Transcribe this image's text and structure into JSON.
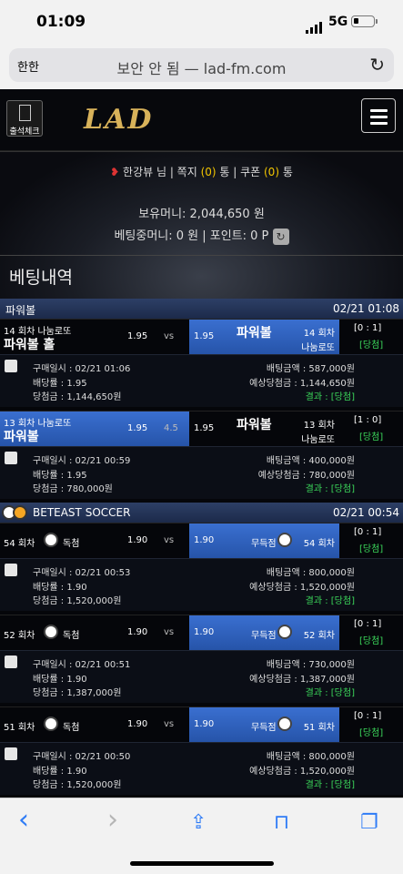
{
  "status": {
    "time": "01:09",
    "network": "5G"
  },
  "url_bar": {
    "aa": "한한",
    "address": "보안 안 됨 — lad-fm.com"
  },
  "site": {
    "attendance_label": "출석체크",
    "logo": "LAD"
  },
  "user": {
    "line": [
      "한강뷰 님 | 쪽지 ",
      "(0)",
      " 통 | 쿠폰 ",
      "(0)",
      " 통"
    ],
    "balance": "보유머니: 2,044,650 원",
    "betting": "베팅중머니: 0 원 | 포인트: 0 P"
  },
  "page_title": "베팅내역",
  "sections": [
    {
      "name": "파워볼",
      "datetime": "02/21 01:08",
      "bets": [
        {
          "home_top": "14 회차 나눔로또",
          "home_name": "파워볼 홀",
          "home_odds": "1.95",
          "mid": "vs",
          "away_odds": "1.95",
          "away_name": "파워볼",
          "away_round": "14 회차",
          "away_sub": "나눔로또",
          "score": "[0 : 1]",
          "result": "[당첨]",
          "selected": "away",
          "purchase": "구매일시 : 02/21 01:06",
          "bet_amount": "배팅금액 : 587,000원",
          "odds": "배당률 : 1.95",
          "expected": "예상당첨금 : 1,144,650원",
          "payout": "당첨금 : 1,144,650원",
          "result_line": "결과 : [당첨]"
        },
        {
          "home_top": "13 회차 나눔로또",
          "home_name": "파워볼",
          "home_odds": "1.95",
          "mid": "4.5",
          "away_odds": "1.95",
          "away_name": "파워볼",
          "away_round": "13 회차",
          "away_sub": "나눔로또",
          "score": "[1 : 0]",
          "result": "[당첨]",
          "selected": "home",
          "purchase": "구매일시 : 02/21 00:59",
          "bet_amount": "배팅금액 : 400,000원",
          "odds": "배당률 : 1.95",
          "expected": "예상당첨금 : 780,000원",
          "payout": "당첨금 : 780,000원",
          "result_line": "결과 : [당첨]"
        }
      ]
    },
    {
      "name": "BETEAST SOCCER",
      "datetime": "02/21 00:54",
      "bets": [
        {
          "home_top": "54 회차",
          "home_name": "독첨",
          "home_odds": "1.90",
          "mid": "vs",
          "away_odds": "1.90",
          "away_name": "무득점",
          "away_round": "54 회차",
          "score": "[0 : 1]",
          "result": "[당첨]",
          "selected": "away",
          "purchase": "구매일시 : 02/21 00:53",
          "bet_amount": "배팅금액 : 800,000원",
          "odds": "배당률 : 1.90",
          "expected": "예상당첨금 : 1,520,000원",
          "payout": "당첨금 : 1,520,000원",
          "result_line": "결과 : [당첨]"
        },
        {
          "home_top": "52 회차",
          "home_name": "독첨",
          "home_odds": "1.90",
          "mid": "vs",
          "away_odds": "1.90",
          "away_name": "무득점",
          "away_round": "52 회차",
          "score": "[0 : 1]",
          "result": "[당첨]",
          "selected": "away",
          "purchase": "구매일시 : 02/21 00:51",
          "bet_amount": "배팅금액 : 730,000원",
          "odds": "배당률 : 1.90",
          "expected": "예상당첨금 : 1,387,000원",
          "payout": "당첨금 : 1,387,000원",
          "result_line": "결과 : [당첨]"
        },
        {
          "home_top": "51 회차",
          "home_name": "독첨",
          "home_odds": "1.90",
          "mid": "vs",
          "away_odds": "1.90",
          "away_name": "무득점",
          "away_round": "51 회차",
          "score": "[0 : 1]",
          "result": "[당첨]",
          "selected": "away",
          "purchase": "구매일시 : 02/21 00:50",
          "bet_amount": "배팅금액 : 800,000원",
          "odds": "배당률 : 1.90",
          "expected": "예상당첨금 : 1,520,000원",
          "payout": "당첨금 : 1,520,000원",
          "result_line": "결과 : [당첨]"
        }
      ]
    }
  ],
  "toolbar": {
    "back": "‹",
    "forward": "›",
    "share": "⇪",
    "bookmarks": "⊓",
    "tabs": "❐"
  },
  "colors": {
    "accent_blue": "#2f7cf6",
    "win_green": "#3bd65a",
    "gold": "#d8b25a"
  }
}
